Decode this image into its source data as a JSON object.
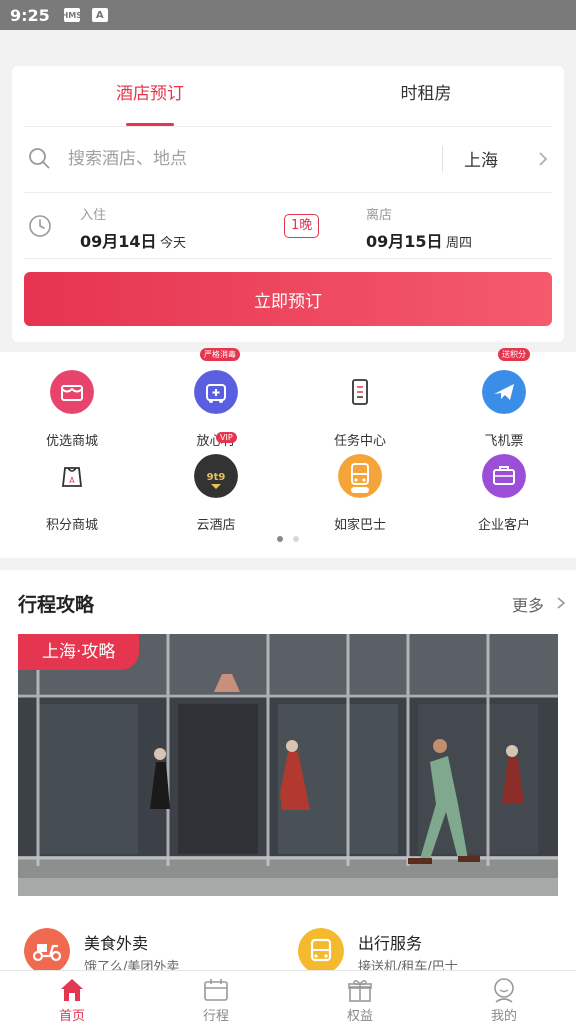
{
  "status_bar": {
    "time": "9:25",
    "icons": [
      "hms-icon",
      "a-icon"
    ]
  },
  "booking": {
    "tabs": [
      {
        "label": "酒店预订",
        "active": true
      },
      {
        "label": "时租房",
        "active": false
      }
    ],
    "search": {
      "placeholder": "搜索酒店、地点",
      "value": "",
      "city": "上海"
    },
    "checkin": {
      "label": "入住",
      "date": "09月14日",
      "day": "今天"
    },
    "checkout": {
      "label": "离店",
      "date": "09月15日",
      "day": "周四"
    },
    "nights": "1晚",
    "book_button": "立即预订"
  },
  "services": [
    {
      "label": "优选商城",
      "icon": "shop-icon",
      "color": "#e8436a"
    },
    {
      "label": "放心行",
      "icon": "safe-travel-icon",
      "color": "#5a5fe0",
      "badge": "严格消毒"
    },
    {
      "label": "任务中心",
      "icon": "task-icon",
      "color": "#ffffff"
    },
    {
      "label": "飞机票",
      "icon": "plane-icon",
      "color": "#3a8ee8",
      "badge": "送积分"
    },
    {
      "label": "积分商城",
      "icon": "points-shop-icon",
      "color": "#ffffff"
    },
    {
      "label": "云酒店",
      "icon": "cloud-hotel-icon",
      "color": "#333333",
      "badge": "VIP"
    },
    {
      "label": "如家巴士",
      "icon": "bus-icon",
      "color": "#f5a43a"
    },
    {
      "label": "企业客户",
      "icon": "briefcase-icon",
      "color": "#9b4fd8"
    }
  ],
  "pager": {
    "pages": 2,
    "current": 1
  },
  "guide": {
    "title": "行程攻略",
    "more": "更多",
    "photo_tag": "上海·攻略",
    "features": [
      {
        "title": "美食外卖",
        "subtitle": "饿了么/美团外卖",
        "icon": "food-delivery-icon",
        "color": "#ef6a4e"
      },
      {
        "title": "出行服务",
        "subtitle": "接送机/租车/巴士",
        "icon": "bus-service-icon",
        "color": "#f5b92e"
      }
    ]
  },
  "tabbar": [
    {
      "label": "首页",
      "icon": "home-icon",
      "active": true
    },
    {
      "label": "行程",
      "icon": "itinerary-icon",
      "active": false
    },
    {
      "label": "权益",
      "icon": "gift-icon",
      "active": false
    },
    {
      "label": "我的",
      "icon": "profile-icon",
      "active": false
    }
  ],
  "colors": {
    "accent": "#e5364f"
  }
}
